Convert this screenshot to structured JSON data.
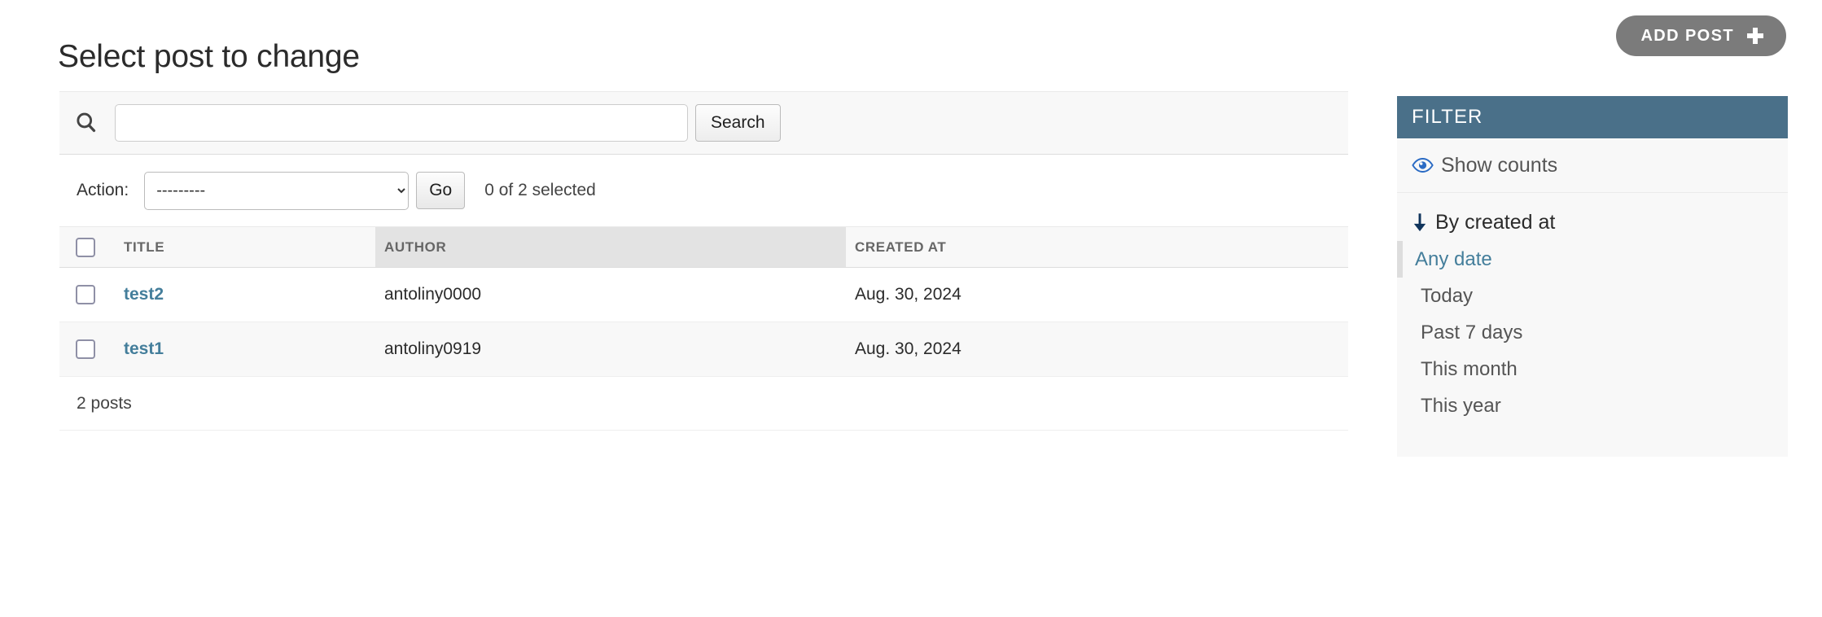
{
  "header": {
    "title": "Select post to change",
    "add_button_label": "ADD POST",
    "add_button_icon": "plus-icon"
  },
  "search": {
    "icon": "search-icon",
    "value": "",
    "placeholder": "",
    "submit_label": "Search"
  },
  "actions": {
    "label": "Action:",
    "selected_option": "---------",
    "options": [
      "---------"
    ],
    "go_label": "Go",
    "selection_counter": "0 of 2 selected"
  },
  "table": {
    "columns": [
      {
        "key": "check",
        "label": "",
        "sorted": false
      },
      {
        "key": "title",
        "label": "TITLE",
        "sorted": false
      },
      {
        "key": "author",
        "label": "AUTHOR",
        "sorted": true
      },
      {
        "key": "created_at",
        "label": "CREATED AT",
        "sorted": false
      }
    ],
    "rows": [
      {
        "title": "test2",
        "author": "antoliny0000",
        "created_at": "Aug. 30, 2024"
      },
      {
        "title": "test1",
        "author": "antoliny0919",
        "created_at": "Aug. 30, 2024"
      }
    ],
    "footer_count": "2 posts"
  },
  "filter": {
    "header": "FILTER",
    "show_counts": {
      "label": "Show counts",
      "icon": "eye-icon"
    },
    "groups": [
      {
        "title": "By created at",
        "icon": "arrow-down-icon",
        "choices": [
          {
            "label": "Any date",
            "selected": true
          },
          {
            "label": "Today",
            "selected": false
          },
          {
            "label": "Past 7 days",
            "selected": false
          },
          {
            "label": "This month",
            "selected": false
          },
          {
            "label": "This year",
            "selected": false
          }
        ]
      }
    ]
  },
  "colors": {
    "filter_header_bg": "#4a7089",
    "link": "#447e9b",
    "add_button_bg": "#7b7b7b",
    "eye_icon": "#2b6bc4",
    "arrow_icon": "#10345c",
    "sorted_header_bg": "#e3e3e3"
  }
}
